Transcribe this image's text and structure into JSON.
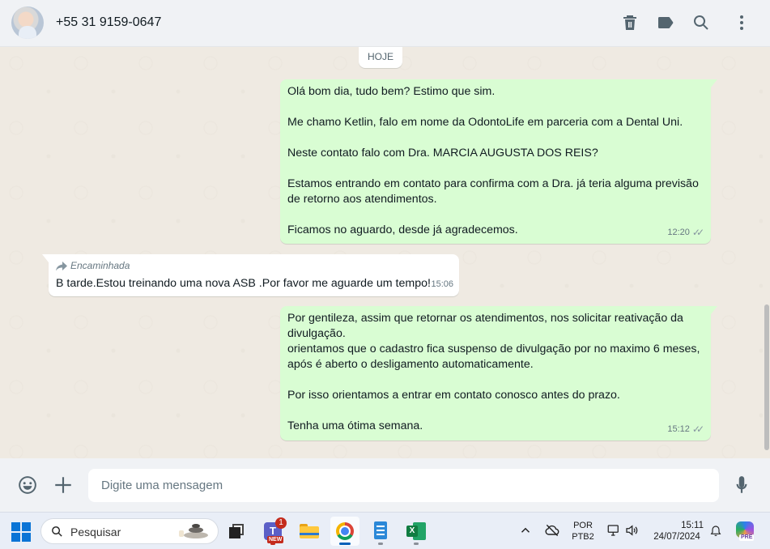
{
  "header": {
    "contact_name": "+55 31 9159-0647",
    "icons": [
      "archive-icon",
      "label-icon",
      "search-icon",
      "more-vertical-icon"
    ]
  },
  "chat": {
    "date_chip": "HOJE",
    "messages": [
      {
        "direction": "outgoing",
        "text": "Olá bom dia, tudo bem? Estimo que sim.\n\nMe chamo Ketlin, falo em nome da OdontoLife em parceria com a Dental Uni.\n\nNeste contato falo com Dra. MARCIA AUGUSTA DOS REIS?\n\nEstamos entrando em contato para confirma com a Dra. já teria alguma previsão de retorno aos atendimentos.\n\nFicamos no aguardo, desde já agradecemos.",
        "time": "12:20",
        "status": "read"
      },
      {
        "direction": "incoming",
        "forwarded_label": "Encaminhada",
        "text": "B tarde.Estou treinando uma nova ASB .Por favor me aguarde um tempo!",
        "time": "15:06"
      },
      {
        "direction": "outgoing",
        "text": "Por gentileza, assim que retornar os atendimentos, nos solicitar reativação da divulgação.\norientamos que o cadastro fica suspenso de divulgação por no maximo 6 meses, após é aberto o desligamento automaticamente.\n\nPor isso orientamos a entrar em contato conosco antes do prazo.\n\nTenha uma ótima semana.",
        "time": "15:12",
        "status": "read"
      }
    ]
  },
  "composer": {
    "placeholder": "Digite uma mensagem"
  },
  "taskbar": {
    "search_label": "Pesquisar",
    "teams_badge": "1",
    "teams_new": "NEW",
    "language_line1": "POR",
    "language_line2": "PTB2",
    "clock_time": "15:11",
    "clock_date": "24/07/2024",
    "copilot_badge": "PRE"
  },
  "colors": {
    "outgoing_bubble": "#d9fdd3",
    "incoming_bubble": "#ffffff",
    "chat_background": "#efeae2",
    "header_background": "#f0f2f5",
    "read_ticks": "#8696a0"
  }
}
